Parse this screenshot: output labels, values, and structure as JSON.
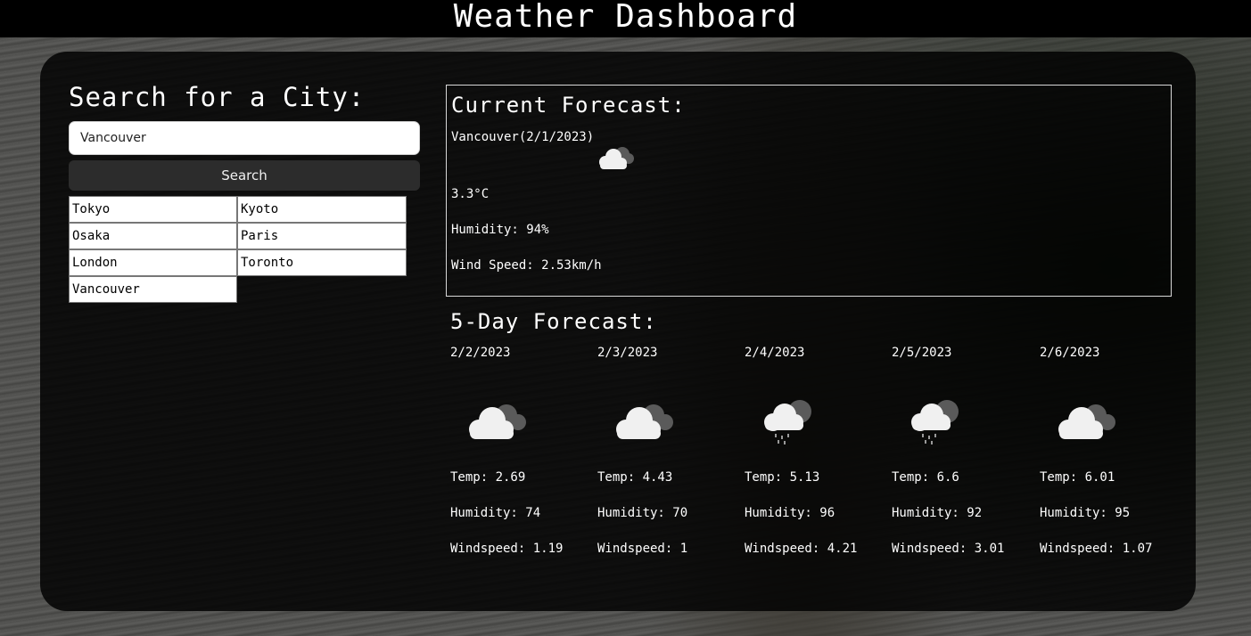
{
  "header": {
    "title": "Weather Dashboard"
  },
  "search": {
    "title": "Search for a City:",
    "input_value": "Vancouver",
    "button_label": "Search",
    "history": [
      "Tokyo",
      "Kyoto",
      "Osaka",
      "Paris",
      "London",
      "Toronto",
      "Vancouver"
    ]
  },
  "current": {
    "title": "Current Forecast:",
    "city_date": "Vancouver(2/1/2023)",
    "icon": "partly-cloudy-icon",
    "temp": "3.3°C",
    "humidity": "Humidity: 94%",
    "wind": "Wind Speed: 2.53km/h"
  },
  "forecast": {
    "title": "5-Day Forecast:",
    "days": [
      {
        "date": "2/2/2023",
        "icon": "cloudy-icon",
        "temp": "Temp: 2.69",
        "humidity": "Humidity: 74",
        "wind": "Windspeed: 1.19"
      },
      {
        "date": "2/3/2023",
        "icon": "cloudy-icon",
        "temp": "Temp: 4.43",
        "humidity": "Humidity: 70",
        "wind": "Windspeed: 1"
      },
      {
        "date": "2/4/2023",
        "icon": "rain-icon",
        "temp": "Temp: 5.13",
        "humidity": "Humidity: 96",
        "wind": "Windspeed: 4.21"
      },
      {
        "date": "2/5/2023",
        "icon": "rain-icon",
        "temp": "Temp: 6.6",
        "humidity": "Humidity: 92",
        "wind": "Windspeed: 3.01"
      },
      {
        "date": "2/6/2023",
        "icon": "cloudy-icon",
        "temp": "Temp: 6.01",
        "humidity": "Humidity: 95",
        "wind": "Windspeed: 1.07"
      }
    ]
  },
  "colors": {
    "header_bg": "#000000",
    "panel_bg": "#000000",
    "text": "#ffffff",
    "button_bg": "#2c2c2c"
  }
}
